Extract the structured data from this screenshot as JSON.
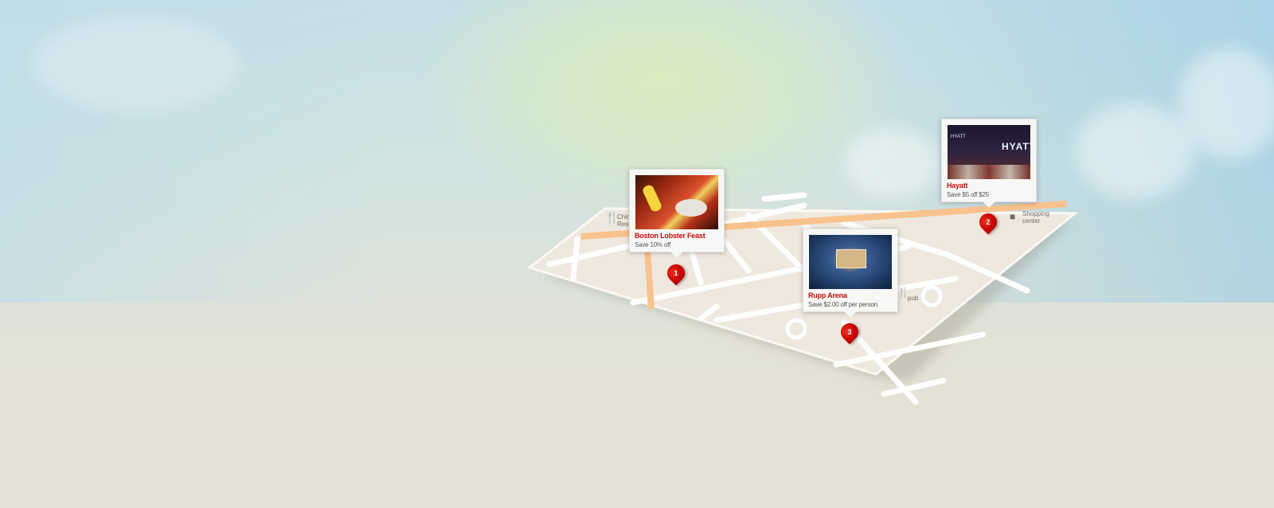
{
  "colors": {
    "accent_red": "#c00d0d",
    "map_ground": "#efe8df",
    "street": "#ffffff",
    "main_road": "#f8c28d"
  },
  "points_of_interest": [
    {
      "icon": "fork-knife-icon",
      "label": "Chin… Resta…"
    },
    {
      "icon": "shopping-bag-icon",
      "label": "Shopping center"
    },
    {
      "icon": "pub-icon",
      "label": "pub"
    }
  ],
  "deals": [
    {
      "marker": "1",
      "title": "Boston Lobster Feast",
      "deal": "Save 10% off",
      "photo": "lobster-feast-photo"
    },
    {
      "marker": "2",
      "title": "Hayatt",
      "deal": "Save $5 off $25",
      "photo": "hyatt-hotel-photo",
      "sign_text": "HYATT"
    },
    {
      "marker": "3",
      "title": "Rupp Arena",
      "deal": "Save $2.00 off per person",
      "photo": "arena-photo"
    }
  ]
}
